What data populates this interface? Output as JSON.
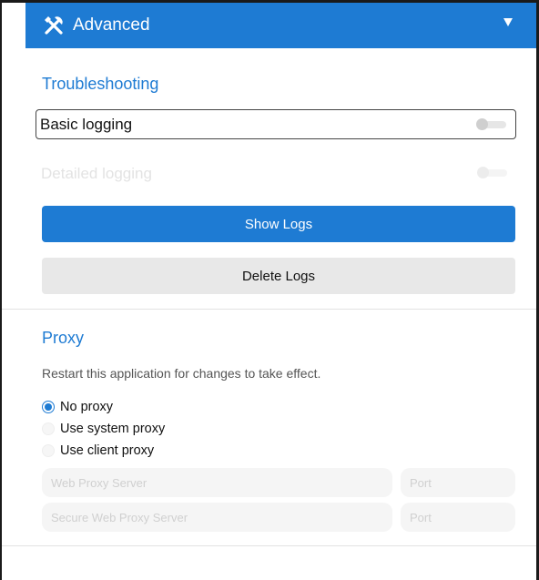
{
  "header": {
    "title": "Advanced",
    "icon": "tools-icon",
    "chevron": "chevron-down-icon",
    "color": "#1e7bd3"
  },
  "troubleshooting": {
    "title": "Troubleshooting",
    "basic_logging": {
      "label": "Basic logging",
      "enabled": false
    },
    "detailed_logging": {
      "label": "Detailed logging",
      "enabled": false,
      "disabled": true
    },
    "show_logs_label": "Show Logs",
    "delete_logs_label": "Delete Logs"
  },
  "proxy": {
    "title": "Proxy",
    "note": "Restart this application for changes to take effect.",
    "options": [
      {
        "label": "No proxy",
        "selected": true
      },
      {
        "label": "Use system proxy",
        "selected": false
      },
      {
        "label": "Use client proxy",
        "selected": false
      }
    ],
    "web_proxy_placeholder": "Web Proxy Server",
    "web_port_placeholder": "Port",
    "secure_proxy_placeholder": "Secure Web Proxy Server",
    "secure_port_placeholder": "Port"
  }
}
